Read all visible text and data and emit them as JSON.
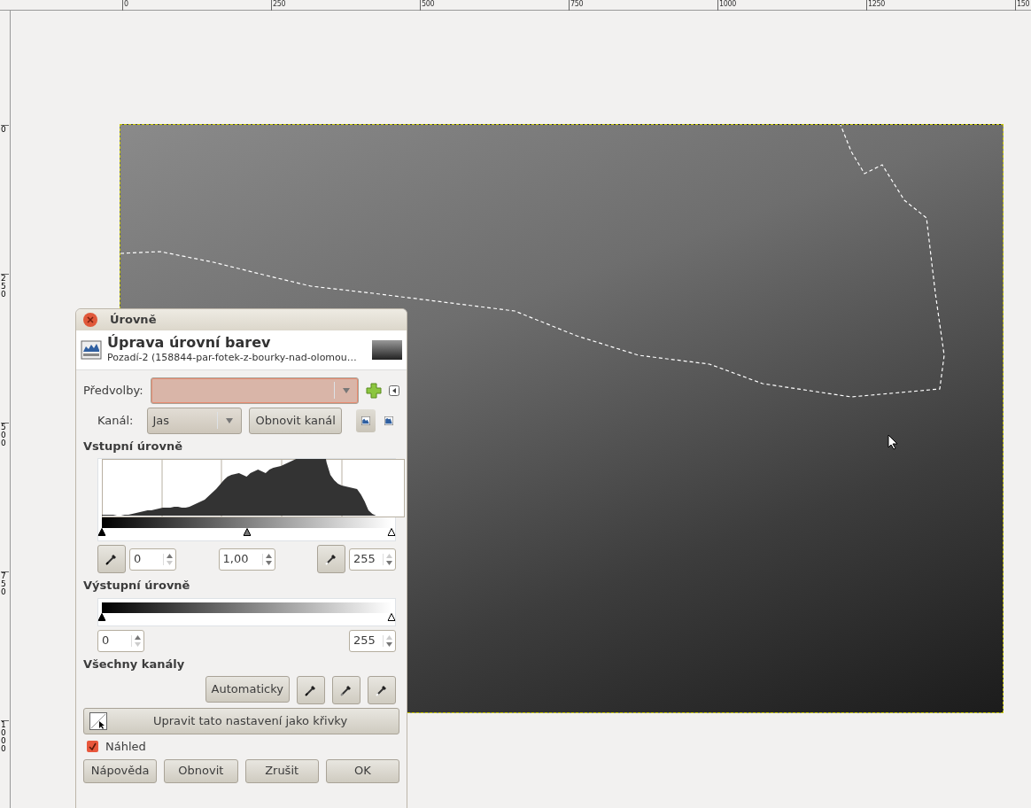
{
  "rulers": {
    "horizontal": [
      "0",
      "250",
      "500",
      "750",
      "1000",
      "1250",
      "150"
    ],
    "vertical": [
      "0",
      "250",
      "500",
      "750",
      "1000"
    ]
  },
  "dialog": {
    "title": "Úrovně",
    "heading": "Úprava úrovní barev",
    "subtitle": "Pozadí-2 (158844-par-fotek-z-bourky-nad-olomou…",
    "presets": {
      "label": "Předvolby:"
    },
    "channel": {
      "label": "Kanál:",
      "value": "Jas",
      "reset_button": "Obnovit kanál"
    },
    "histogram_modes": [
      {
        "kind": "linear",
        "selected": true
      },
      {
        "kind": "logarithmic",
        "selected": false
      }
    ],
    "input_levels": {
      "title": "Vstupní úrovně",
      "handles": [
        {
          "level": 0
        },
        {
          "level": 0.5
        },
        {
          "level": 1
        }
      ],
      "low": "0",
      "gamma": "1,00",
      "high": "255"
    },
    "output_levels": {
      "title": "Výstupní úrovně",
      "handles": [
        {
          "level": 0
        },
        {
          "level": 1
        }
      ],
      "low": "0",
      "high": "255"
    },
    "all_channels": {
      "title": "Všechny kanály",
      "auto_button": "Automaticky"
    },
    "curves_button": "Upravit tato nastavení jako křivky",
    "preview": {
      "label": "Náhled",
      "checked": true
    },
    "buttons": [
      "Nápověda",
      "Obnovit",
      "Zrušit",
      "OK"
    ]
  }
}
